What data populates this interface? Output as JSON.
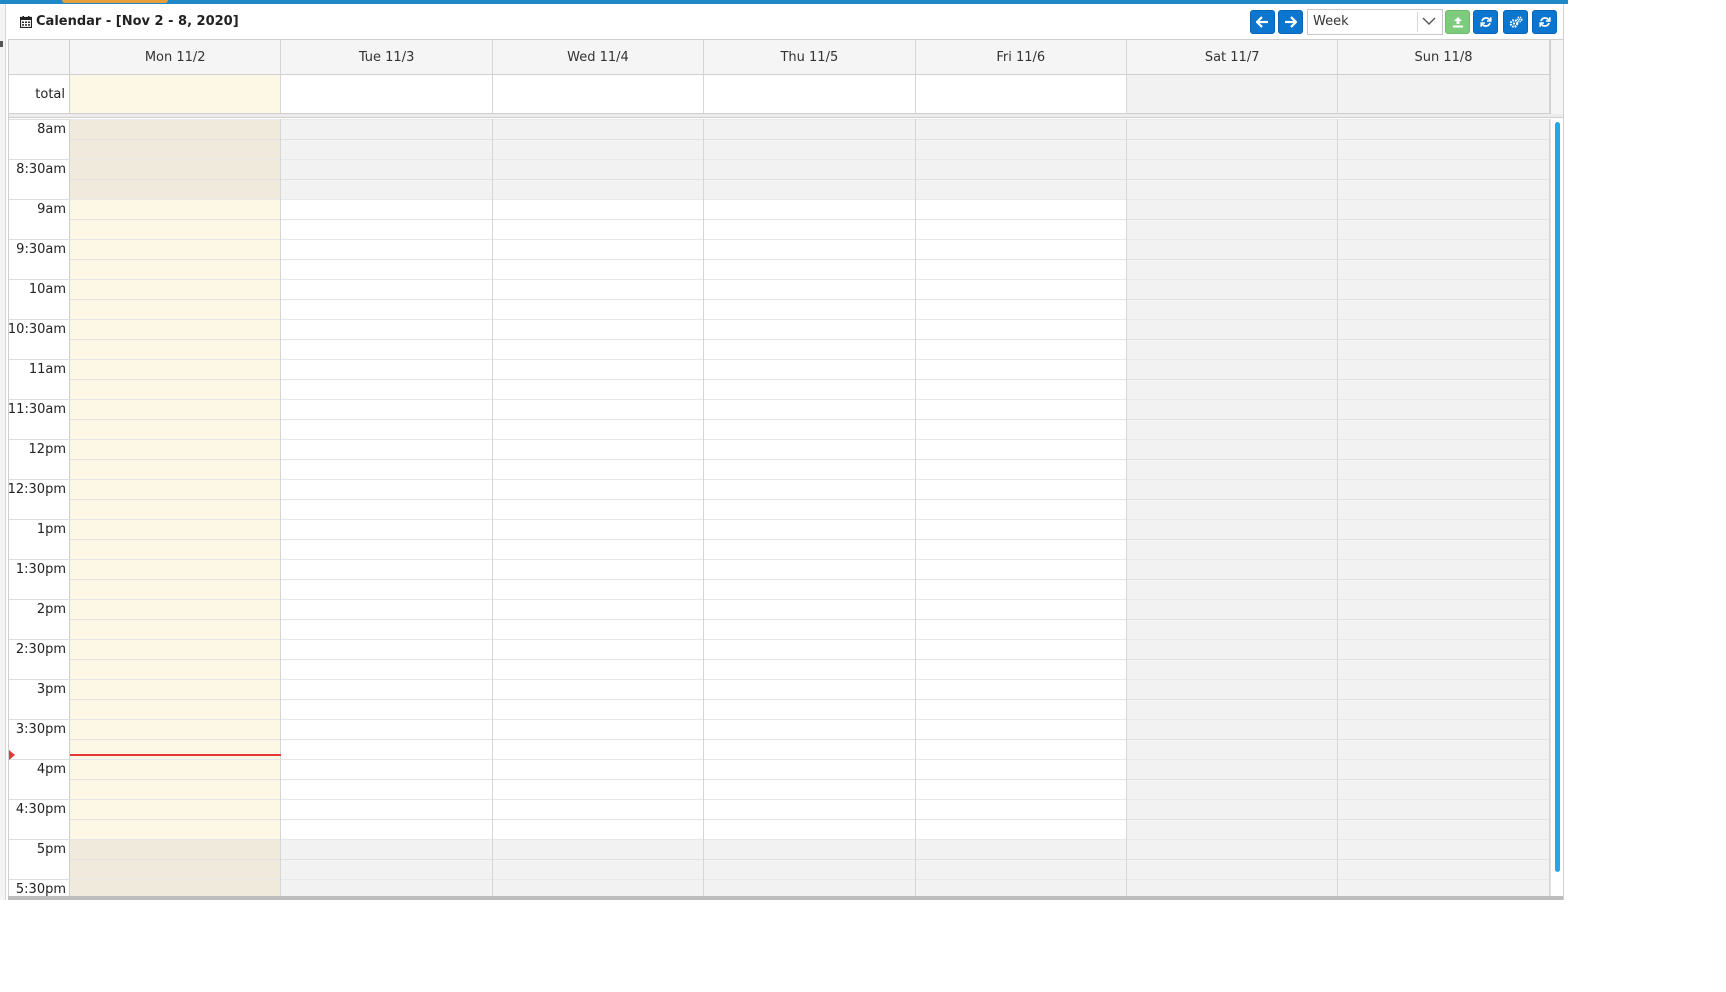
{
  "calendar": {
    "title": "Calendar - [Nov 2 - 8, 2020]",
    "view_select": {
      "value": "Week"
    },
    "toolbar": {
      "prev_icon": "arrow-left-icon",
      "next_icon": "arrow-right-icon",
      "upload_icon": "upload-icon",
      "refresh_icon": "refresh-icon",
      "settings_icon": "cogs-icon",
      "refresh2_icon": "refresh-icon"
    },
    "days": [
      {
        "label": "Mon 11/2",
        "type": "today"
      },
      {
        "label": "Tue 11/3",
        "type": "weekday"
      },
      {
        "label": "Wed 11/4",
        "type": "weekday"
      },
      {
        "label": "Thu 11/5",
        "type": "weekday"
      },
      {
        "label": "Fri 11/6",
        "type": "weekday"
      },
      {
        "label": "Sat 11/7",
        "type": "weekend"
      },
      {
        "label": "Sun 11/8",
        "type": "weekend"
      }
    ],
    "allday_label": "total",
    "time_slots": [
      "8am",
      "8:30am",
      "9am",
      "9:30am",
      "10am",
      "10:30am",
      "11am",
      "11:30am",
      "12pm",
      "12:30pm",
      "1pm",
      "1:30pm",
      "2pm",
      "2:30pm",
      "3pm",
      "3:30pm",
      "4pm",
      "4:30pm",
      "5pm",
      "5:30pm"
    ],
    "business_hours": {
      "start": "9am",
      "end": "5pm"
    },
    "now_indicator": {
      "time": "3:57pm",
      "day": "Mon 11/2"
    }
  },
  "colors": {
    "accent": "#0b76d0",
    "today_bg": "#fdf8e5",
    "nonbusiness_bg": "#f2f2f2",
    "now_line": "#e53935",
    "upload_disabled": "#7ecb7e",
    "scrollbar": "#26a6e8"
  }
}
